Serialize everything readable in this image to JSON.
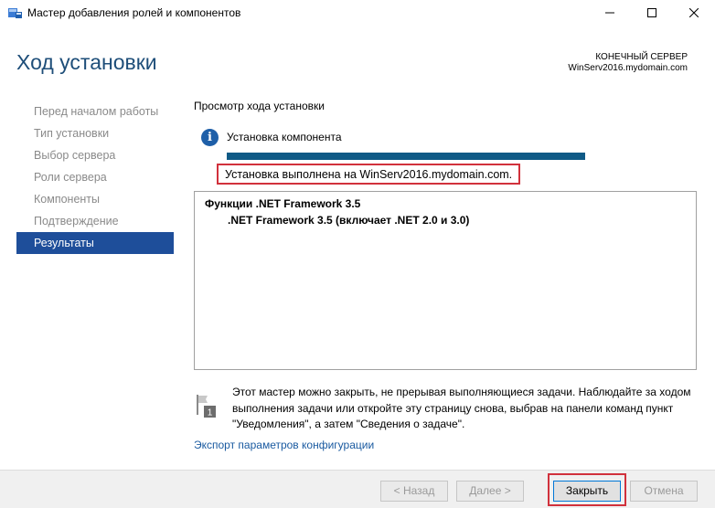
{
  "window": {
    "title": "Мастер добавления ролей и компонентов",
    "icons": {
      "app": "server-manager-icon",
      "minimize": "minimize-icon",
      "maximize": "maximize-icon",
      "close": "close-icon"
    }
  },
  "header": {
    "page_title": "Ход установки",
    "destination_label": "КОНЕЧНЫЙ СЕРВЕР",
    "destination_server": "WinServ2016.mydomain.com"
  },
  "sidebar": {
    "items": [
      {
        "label": "Перед началом работы",
        "active": false
      },
      {
        "label": "Тип установки",
        "active": false
      },
      {
        "label": "Выбор сервера",
        "active": false
      },
      {
        "label": "Роли сервера",
        "active": false
      },
      {
        "label": "Компоненты",
        "active": false
      },
      {
        "label": "Подтверждение",
        "active": false
      },
      {
        "label": "Результаты",
        "active": true
      }
    ]
  },
  "main": {
    "section_title": "Просмотр хода установки",
    "status": {
      "icon": "info-icon",
      "label": "Установка компонента",
      "progress_percent": 100,
      "result": "Установка выполнена на WinServ2016.mydomain.com."
    },
    "features": {
      "name": "Функции .NET Framework 3.5",
      "sub": ".NET Framework 3.5 (включает .NET 2.0 и 3.0)"
    },
    "note": {
      "icon": "notification-flag-icon",
      "badge": "1",
      "text": "Этот мастер можно закрыть, не прерывая выполняющиеся задачи. Наблюдайте за ходом выполнения задачи или откройте эту страницу снова, выбрав на панели команд пункт \"Уведомления\", а затем \"Сведения о задаче\"."
    },
    "export_link": "Экспорт параметров конфигурации"
  },
  "footer": {
    "back": "< Назад",
    "next": "Далее >",
    "close": "Закрыть",
    "cancel": "Отмена"
  },
  "colors": {
    "accent": "#1e4e9a",
    "title": "#1e4e79",
    "progress": "#0f5a86",
    "highlight": "#d1313c",
    "link": "#1a5aa0"
  }
}
